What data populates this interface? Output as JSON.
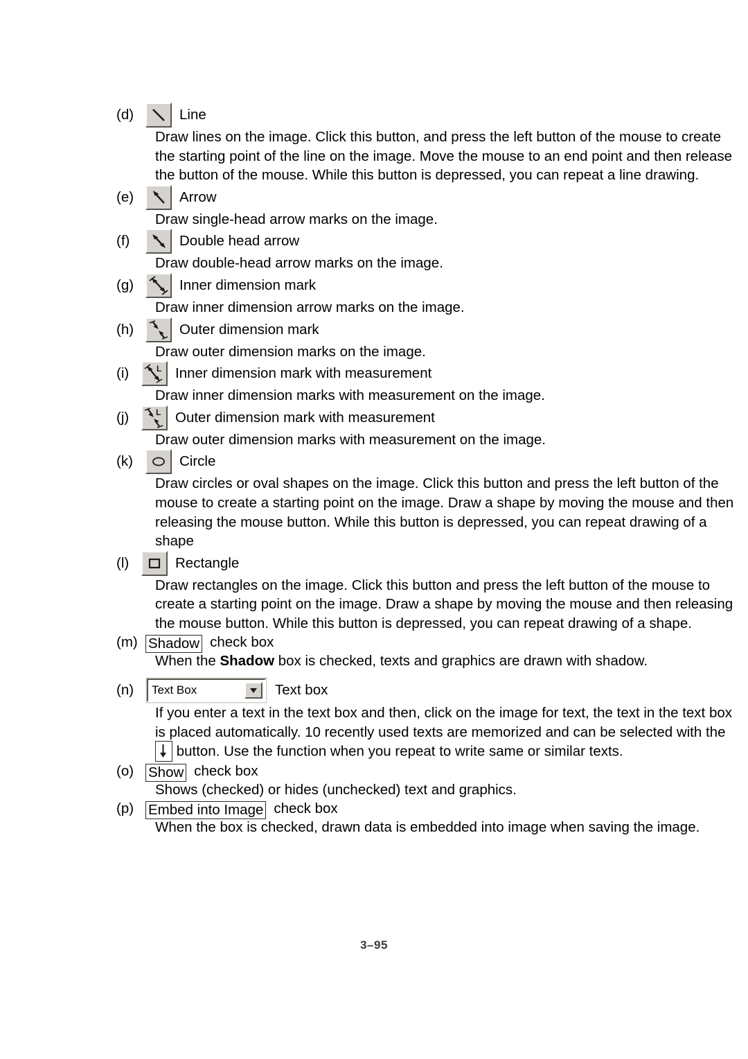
{
  "page": {
    "footer": "3–95"
  },
  "items": [
    {
      "marker": "(d)",
      "icon": "line-tool-icon",
      "label": "Line",
      "desc": "Draw lines on the image. Click this button, and press the left button of the mouse to create the starting point of the line on the image. Move the mouse to an end point and then release the button of the mouse. While this button is depressed, you can repeat a line drawing."
    },
    {
      "marker": "(e)",
      "icon": "arrow-tool-icon",
      "label": "Arrow",
      "desc": "Draw single-head arrow marks on the image."
    },
    {
      "marker": "(f)",
      "icon": "double-head-arrow-tool-icon",
      "label": "Double head arrow",
      "desc": "Draw double-head arrow marks on the image."
    },
    {
      "marker": "(g)",
      "icon": "inner-dimension-mark-tool-icon",
      "label": "Inner dimension mark",
      "desc": "Draw inner dimension arrow marks on the image."
    },
    {
      "marker": "(h)",
      "icon": "outer-dimension-mark-tool-icon",
      "label": "Outer dimension mark",
      "desc": "Draw outer dimension marks on the image."
    },
    {
      "marker": "(i)",
      "icon": "inner-dimension-mark-measurement-tool-icon",
      "label": "Inner dimension mark with measurement",
      "desc": "Draw inner dimension marks with measurement on the image."
    },
    {
      "marker": "(j)",
      "icon": "outer-dimension-mark-measurement-tool-icon",
      "label": "Outer dimension mark with measurement",
      "desc": "Draw outer dimension marks with measurement on the image."
    },
    {
      "marker": "(k)",
      "icon": "circle-tool-icon",
      "label": "Circle",
      "desc": "Draw circles or oval shapes on the image. Click this button and press the left button of the mouse to create a starting point on the image. Draw a shape by moving the mouse and then releasing the mouse button. While this button is depressed, you can repeat drawing of a shape"
    },
    {
      "marker": "(l)",
      "icon": "rectangle-tool-icon",
      "label": "Rectangle",
      "desc": "Draw rectangles on the image. Click this button and press the left button of the mouse to create a starting point on the image. Draw a shape by moving the mouse and then releasing the mouse button. While this button is depressed, you can repeat drawing of a shape."
    }
  ],
  "shadow_item": {
    "marker": "(m)",
    "keyword": "Shadow",
    "suffix": "check box",
    "desc_before": "When the ",
    "desc_bold": "Shadow",
    "desc_after": " box is checked, texts and graphics are drawn with shadow."
  },
  "textbox_item": {
    "marker": "(n)",
    "combo_value": "Text Box",
    "combo_arrow_icon": "chevron-down-icon",
    "label": "Text box",
    "desc_part1": "If you enter a text in the text box and then, click on the image for text, the text in the text box is placed automatically. 10 recently used texts are memorized and can be selected with the",
    "inline_button_icon": "arrow-down-icon",
    "desc_part2": "button. Use the function when you repeat to write same or similar texts."
  },
  "show_item": {
    "marker": "(o)",
    "keyword": "Show",
    "suffix": "check box",
    "desc": "Shows (checked) or hides (unchecked) text and graphics."
  },
  "embed_item": {
    "marker": "(p)",
    "keyword": "Embed into Image",
    "suffix": "check box",
    "desc": "When the box is checked, drawn data is embedded into image when saving the image."
  }
}
